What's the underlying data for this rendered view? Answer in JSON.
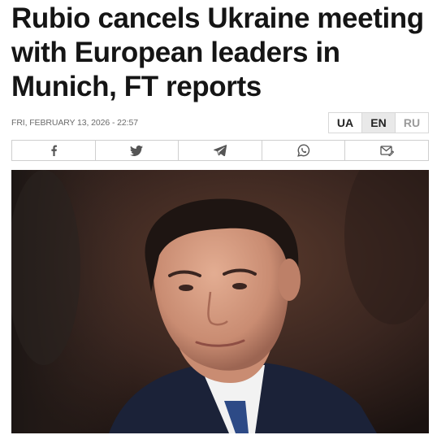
{
  "article": {
    "headline": "Rubio cancels Ukraine meeting with European leaders in Munich, FT reports",
    "date": "FRI, FEBRUARY 13, 2026 - 22:57"
  },
  "languages": [
    {
      "code": "UA",
      "state": "available"
    },
    {
      "code": "EN",
      "state": "active"
    },
    {
      "code": "RU",
      "state": "muted"
    }
  ],
  "share": {
    "icons": [
      "facebook-icon",
      "twitter-icon",
      "telegram-icon",
      "whatsapp-icon",
      "email-icon"
    ]
  },
  "photo": {
    "colors": {
      "background": "#3a2620",
      "suit": "#1b2238",
      "skin": "#d49a80",
      "hair": "#1e1512"
    }
  }
}
